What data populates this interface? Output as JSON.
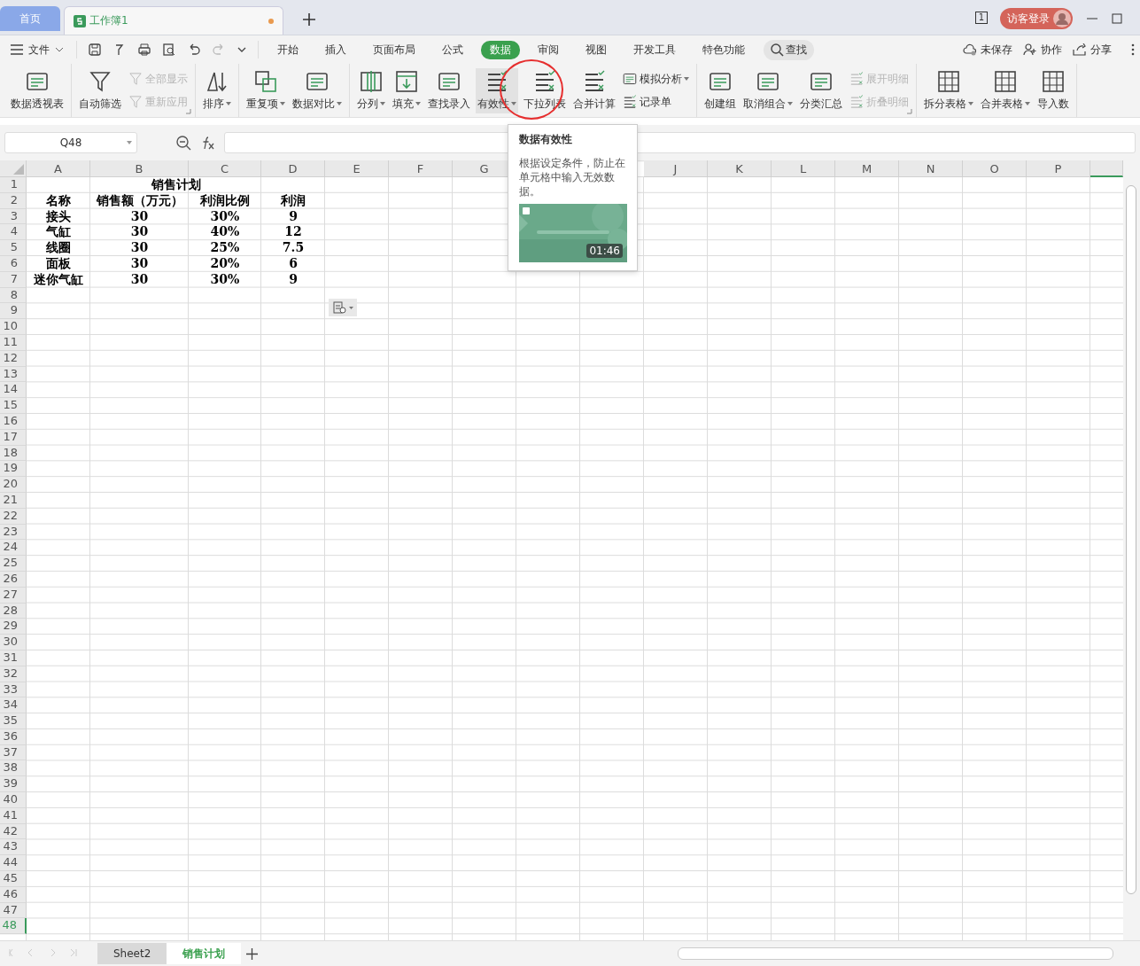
{
  "doc_tabs": [
    {
      "label": "首页",
      "kind": "home",
      "selected": false
    },
    {
      "label": "工作簿1",
      "kind": "doc",
      "selected": true,
      "modified": true
    }
  ],
  "title_bar": {
    "page_count": "1",
    "login": "访客登录"
  },
  "menu": {
    "file": "文件",
    "tabs": [
      {
        "label": "开始",
        "selected": false
      },
      {
        "label": "插入",
        "selected": false
      },
      {
        "label": "页面布局",
        "selected": false
      },
      {
        "label": "公式",
        "selected": false
      },
      {
        "label": "数据",
        "selected": true
      },
      {
        "label": "审阅",
        "selected": false
      },
      {
        "label": "视图",
        "selected": false
      },
      {
        "label": "开发工具",
        "selected": false
      },
      {
        "label": "特色功能",
        "selected": false
      }
    ],
    "search": "查找",
    "actions": [
      "未保存",
      "协作",
      "分享"
    ]
  },
  "ribbon": [
    {
      "launcher": false,
      "columns": [
        [
          {
            "label": "数据透视表",
            "dropdown": false,
            "disabled": false,
            "hovered": false
          }
        ]
      ]
    },
    {
      "launcher": true,
      "columns": [
        [
          {
            "label": "自动筛选",
            "dropdown": false,
            "disabled": false,
            "hovered": false
          }
        ],
        [
          {
            "label": "全部显示",
            "dropdown": false,
            "disabled": true,
            "hovered": false
          },
          {
            "label": "重新应用",
            "dropdown": false,
            "disabled": true,
            "hovered": false
          }
        ]
      ]
    },
    {
      "launcher": false,
      "columns": [
        [
          {
            "label": "排序",
            "dropdown": true,
            "disabled": false,
            "hovered": false
          }
        ]
      ]
    },
    {
      "launcher": false,
      "columns": [
        [
          {
            "label": "重复项",
            "dropdown": true,
            "disabled": false,
            "hovered": false
          }
        ],
        [
          {
            "label": "数据对比",
            "dropdown": true,
            "disabled": false,
            "hovered": false
          }
        ]
      ]
    },
    {
      "launcher": false,
      "columns": [
        [
          {
            "label": "分列",
            "dropdown": true,
            "disabled": false,
            "hovered": false
          }
        ],
        [
          {
            "label": "填充",
            "dropdown": true,
            "disabled": false,
            "hovered": false
          }
        ],
        [
          {
            "label": "查找录入",
            "dropdown": false,
            "disabled": false,
            "hovered": false
          }
        ],
        [
          {
            "label": "有效性",
            "dropdown": true,
            "disabled": false,
            "hovered": true
          }
        ],
        [
          {
            "label": "下拉列表",
            "dropdown": false,
            "disabled": false,
            "hovered": false
          }
        ],
        [
          {
            "label": "合并计算",
            "dropdown": false,
            "disabled": false,
            "hovered": false
          }
        ],
        [
          {
            "label": "模拟分析",
            "dropdown": true,
            "disabled": false,
            "hovered": false
          },
          {
            "label": "记录单",
            "dropdown": false,
            "disabled": false,
            "hovered": false
          }
        ]
      ]
    },
    {
      "launcher": true,
      "columns": [
        [
          {
            "label": "创建组",
            "dropdown": false,
            "disabled": false,
            "hovered": false
          }
        ],
        [
          {
            "label": "取消组合",
            "dropdown": true,
            "disabled": false,
            "hovered": false
          }
        ],
        [
          {
            "label": "分类汇总",
            "dropdown": false,
            "disabled": false,
            "hovered": false
          }
        ],
        [
          {
            "label": "展开明细",
            "dropdown": false,
            "disabled": true,
            "hovered": false
          },
          {
            "label": "折叠明细",
            "dropdown": false,
            "disabled": true,
            "hovered": false
          }
        ]
      ]
    },
    {
      "launcher": false,
      "columns": [
        [
          {
            "label": "拆分表格",
            "dropdown": true,
            "disabled": false,
            "hovered": false
          }
        ],
        [
          {
            "label": "合并表格",
            "dropdown": true,
            "disabled": false,
            "hovered": false
          }
        ],
        [
          {
            "label": "导入数",
            "dropdown": false,
            "disabled": false,
            "hovered": false
          }
        ]
      ]
    }
  ],
  "formula_bar": {
    "name_box": "Q48"
  },
  "tooltip": {
    "title": "数据有效性",
    "text": "根据设定条件，防止在单元格中输入无效数据。",
    "video": {
      "kind": "picture",
      "duration": "01:46"
    }
  },
  "sheet": {
    "columns": [
      "A",
      "B",
      "C",
      "D",
      "E",
      "F",
      "G",
      null,
      null,
      "J",
      "K",
      "L",
      "M",
      "N",
      "O",
      "P"
    ],
    "title": "销售计划",
    "header": [
      "名称",
      "销售额（万元）",
      "利润比例",
      "利润"
    ],
    "rows": [
      [
        "接头",
        "30",
        "30%",
        "9"
      ],
      [
        "气缸",
        "30",
        "40%",
        "12"
      ],
      [
        "线圈",
        "30",
        "25%",
        "7.5"
      ],
      [
        "面板",
        "30",
        "20%",
        "6"
      ],
      [
        "迷你气缸",
        "30",
        "30%",
        "9"
      ]
    ],
    "row_numbers": [
      "1",
      "2",
      "3",
      "4",
      "5",
      "6",
      "7",
      "8",
      "9",
      "10",
      "11",
      "12",
      "13",
      "14",
      "15",
      "16",
      "17",
      "18",
      "19",
      "20",
      "21",
      "22",
      "23",
      "24",
      "25",
      "26",
      "27",
      "28",
      "29",
      "30",
      "31",
      "32",
      "33",
      "34",
      "35",
      "36",
      "37",
      "38",
      "39",
      "40",
      "41",
      "42",
      "43",
      "44",
      "45",
      "46",
      "47",
      "48"
    ]
  },
  "sheet_tabs": [
    {
      "label": "Sheet2",
      "selected": false
    },
    {
      "label": "销售计划",
      "selected": true
    }
  ]
}
